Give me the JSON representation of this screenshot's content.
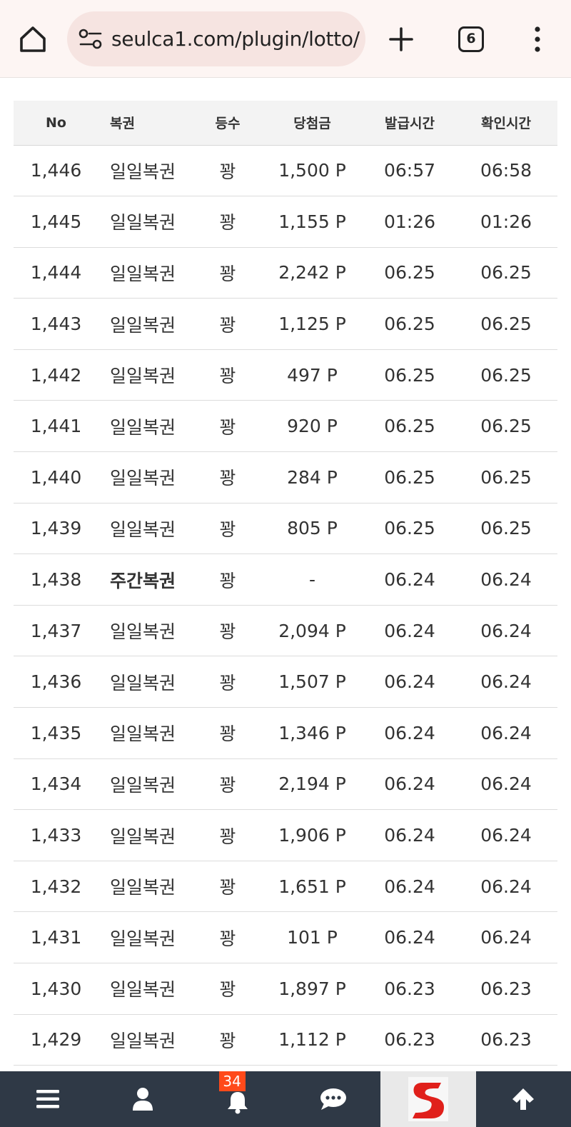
{
  "browser": {
    "url": "seulca1.com/plugin/lotto/",
    "tab_count": "6",
    "icons": [
      "home-icon",
      "site-info-icon",
      "plus-icon",
      "tabs-icon",
      "more-vert-icon"
    ]
  },
  "table": {
    "headers": {
      "no": "No",
      "type": "복권",
      "rank": "등수",
      "prize": "당첨금",
      "issue_time": "발급시간",
      "check_time": "확인시간"
    },
    "rows": [
      {
        "no": "1,446",
        "type": "일일복권",
        "rank": "꽝",
        "prize": "1,500 P",
        "issue": "06:57",
        "check": "06:58"
      },
      {
        "no": "1,445",
        "type": "일일복권",
        "rank": "꽝",
        "prize": "1,155 P",
        "issue": "01:26",
        "check": "01:26"
      },
      {
        "no": "1,444",
        "type": "일일복권",
        "rank": "꽝",
        "prize": "2,242 P",
        "issue": "06.25",
        "check": "06.25"
      },
      {
        "no": "1,443",
        "type": "일일복권",
        "rank": "꽝",
        "prize": "1,125 P",
        "issue": "06.25",
        "check": "06.25"
      },
      {
        "no": "1,442",
        "type": "일일복권",
        "rank": "꽝",
        "prize": "497 P",
        "issue": "06.25",
        "check": "06.25"
      },
      {
        "no": "1,441",
        "type": "일일복권",
        "rank": "꽝",
        "prize": "920 P",
        "issue": "06.25",
        "check": "06.25"
      },
      {
        "no": "1,440",
        "type": "일일복권",
        "rank": "꽝",
        "prize": "284 P",
        "issue": "06.25",
        "check": "06.25"
      },
      {
        "no": "1,439",
        "type": "일일복권",
        "rank": "꽝",
        "prize": "805 P",
        "issue": "06.25",
        "check": "06.25"
      },
      {
        "no": "1,438",
        "type": "주간복권",
        "rank": "꽝",
        "prize": "-",
        "issue": "06.24",
        "check": "06.24"
      },
      {
        "no": "1,437",
        "type": "일일복권",
        "rank": "꽝",
        "prize": "2,094 P",
        "issue": "06.24",
        "check": "06.24"
      },
      {
        "no": "1,436",
        "type": "일일복권",
        "rank": "꽝",
        "prize": "1,507 P",
        "issue": "06.24",
        "check": "06.24"
      },
      {
        "no": "1,435",
        "type": "일일복권",
        "rank": "꽝",
        "prize": "1,346 P",
        "issue": "06.24",
        "check": "06.24"
      },
      {
        "no": "1,434",
        "type": "일일복권",
        "rank": "꽝",
        "prize": "2,194 P",
        "issue": "06.24",
        "check": "06.24"
      },
      {
        "no": "1,433",
        "type": "일일복권",
        "rank": "꽝",
        "prize": "1,906 P",
        "issue": "06.24",
        "check": "06.24"
      },
      {
        "no": "1,432",
        "type": "일일복권",
        "rank": "꽝",
        "prize": "1,651 P",
        "issue": "06.24",
        "check": "06.24"
      },
      {
        "no": "1,431",
        "type": "일일복권",
        "rank": "꽝",
        "prize": "101 P",
        "issue": "06.24",
        "check": "06.24"
      },
      {
        "no": "1,430",
        "type": "일일복권",
        "rank": "꽝",
        "prize": "1,897 P",
        "issue": "06.23",
        "check": "06.23"
      },
      {
        "no": "1,429",
        "type": "일일복권",
        "rank": "꽝",
        "prize": "1,112 P",
        "issue": "06.23",
        "check": "06.23"
      }
    ]
  },
  "bottom_nav": {
    "notification_count": "34",
    "items": [
      "menu-icon",
      "user-icon",
      "bell-icon",
      "chat-icon",
      "site-logo",
      "arrow-up-icon"
    ]
  },
  "colors": {
    "browser_bg": "#fdf5f3",
    "url_pill_bg": "#f6e4e1",
    "table_header_bg": "#f3f3f3",
    "bottom_nav_bg": "#2f3946",
    "badge_bg": "#ff4a1a",
    "logo_red": "#e0201b"
  }
}
